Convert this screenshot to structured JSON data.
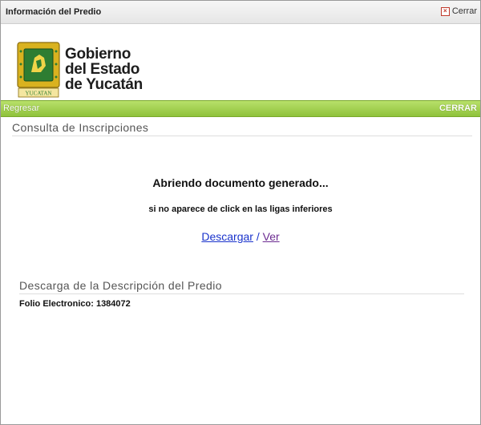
{
  "window": {
    "title": "Información del Predio",
    "close_label": "Cerrar"
  },
  "header": {
    "org_line1": "Gobierno",
    "org_line2": "del Estado",
    "org_line3": "de Yucatán",
    "logo_text": "YUCATAN"
  },
  "nav": {
    "back_label": "Regresar",
    "close_label": "CERRAR"
  },
  "main": {
    "section_title": "Consulta de Inscripciones",
    "status_message": "Abriendo documento generado...",
    "hint_message": "si no aparece de click en las ligas inferiores",
    "download_link": "Descargar",
    "separator": " / ",
    "view_link": "Ver"
  },
  "description": {
    "section_title": "Descarga de la Descripción del Predio",
    "folio": "Folio Electronico: 1384072"
  },
  "colors": {
    "accent_green": "#8fc23b",
    "shield_gold": "#d9b21f",
    "shield_green": "#2e7d32"
  }
}
